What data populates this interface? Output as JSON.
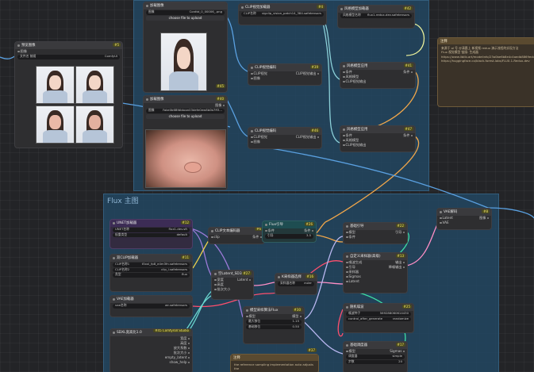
{
  "groups": {
    "top": {
      "title": ""
    },
    "bottom": {
      "title": "Flux 主图"
    }
  },
  "nodes": {
    "load_image_1": {
      "title": "加载图像",
      "filename_label": "图像",
      "filename": "Conttd_0_00006_.png",
      "button": "choose file to upload",
      "badge": "#45"
    },
    "load_image_2": {
      "title": "加载图像",
      "filename_label": "图像",
      "filename": "Fake0b6Bfdbtoon03defe0ew6b0b7ff3...",
      "button": "choose file to upload",
      "badge": "#40",
      "out_image": "图像",
      "out_mask": "遮罩"
    },
    "preview": {
      "title": "预览图像",
      "badge": "#5",
      "filename_label": "文件名 前缀",
      "filename": "ComfyUI",
      "in_images": "图像"
    },
    "clip_vision_loader": {
      "title": "CLIP视觉加载器",
      "badge": "#4",
      "label": "CLIP名称",
      "value": "sigclip_vision_patch14_384.safetensors",
      "out": "CLIP视觉"
    },
    "style_model_loader": {
      "title": "风格模型加载器",
      "badge": "#42",
      "label": "风格模型名称",
      "value": "flux1-redux-dev.safetensors",
      "out": "风格模型"
    },
    "clip_vision_encode_1": {
      "title": "CLIP视觉编码",
      "badge": "#39",
      "in1": "CLIP视觉",
      "in2": "图像",
      "out": "CLIP视觉输出"
    },
    "clip_vision_encode_2": {
      "title": "CLIP视觉编码",
      "badge": "#46",
      "in1": "CLIP视觉",
      "in2": "图像",
      "out": "CLIP视觉输出"
    },
    "apply_style_1": {
      "title": "风格模型应用",
      "badge": "#41",
      "in1": "条件",
      "in2": "风格模型",
      "in3": "CLIP视觉输出",
      "out": "条件"
    },
    "apply_style_2": {
      "title": "风格模型应用",
      "badge": "#47",
      "in1": "条件",
      "in2": "风格模型",
      "in3": "CLIP视觉输出",
      "out": "条件"
    },
    "note_top": {
      "title": "注释",
      "body": "来源于 ol 号 @清晨上 新视频 redux 演示流程的实现方法\nFlux 视觉模型 链接: 生成器\nhttps://www.liblib.art/modelinfo/23a0be6b8e4c4aedb8869ecbc58a03ca\nhttps://huggingface.co/black-forest-labs/FLUX.1-Redux-dev"
    },
    "unet_loader": {
      "title": "UNET加载器",
      "badge": "#12",
      "label1": "UNET名称",
      "value1": "flux1-dev.sft",
      "label2": "权重类型",
      "value2": "default",
      "out": "模型"
    },
    "dual_clip_loader": {
      "title": "双CLIP加载器",
      "badge": "#11",
      "label1": "CLIP名称1",
      "value1": "t5xxl_fp8_e4m3fn.safetensors",
      "label2": "CLIP名称2",
      "value2": "clip_l.safetensors",
      "label3": "类型",
      "value3": "flux",
      "out": "CLIP"
    },
    "vae_loader": {
      "title": "VAE加载器",
      "badge": "#10",
      "label": "vae名称",
      "value": "ae.safetensors",
      "out": "VAE"
    },
    "clip_text_encode": {
      "title": "CLIP文本编码器",
      "badge": "#6",
      "in": "clip",
      "out": "条件"
    },
    "flux_guidance": {
      "title": "Flux引导",
      "badge": "#26",
      "in": "条件",
      "label": "引导",
      "value": "3.5",
      "out": "条件"
    },
    "empty_latent": {
      "title": "空Latent_SD3",
      "badge": "#27",
      "label1": "宽度",
      "label2": "高度",
      "label3": "批次大小",
      "out": "Latent"
    },
    "model_sampling": {
      "title": "模型采样算法Flux",
      "badge": "#30",
      "in": "模型",
      "label1": "最大移位",
      "value1": "1.15",
      "label2": "基础移位",
      "value2": "0.50",
      "out": "模型"
    },
    "ksampler_select": {
      "title": "K采样器选择",
      "badge": "#16",
      "label": "采样器名称",
      "value": "euler",
      "out": "采样器"
    },
    "basic_guider": {
      "title": "基础引导",
      "badge": "#22",
      "in1": "模型",
      "in2": "条件",
      "out": "引导"
    },
    "custom_sampler": {
      "title": "自定义采样器(高级)",
      "badge": "#13",
      "in1": "噪波生成",
      "in2": "引导",
      "in3": "采样器",
      "in4": "Sigmas",
      "in5": "Latent",
      "out1": "输出",
      "out2": "降噪输出"
    },
    "random_noise": {
      "title": "随机噪波",
      "badge": "#25",
      "label1": "噪波种子",
      "value1": "569288060614430",
      "label2": "control_after_generate",
      "value2": "randomize"
    },
    "basic_scheduler": {
      "title": "基础调度器",
      "badge": "#17",
      "in": "模型",
      "label1": "调度器",
      "value1": "simple",
      "label2": "步数",
      "value2": "20",
      "out": "Sigmas"
    },
    "vae_decode": {
      "title": "VAE解码",
      "badge": "#8",
      "in1": "Latent",
      "in2": "VAE",
      "out": "图像"
    },
    "resolution": {
      "title": "SDXL宽高比1.0",
      "badge": "#45 Comfyroll Studio",
      "out1": "宽度",
      "out2": "高度",
      "out3": "放大系数",
      "out4": "批次大小",
      "out5": "empty_latent",
      "out6": "show_help"
    },
    "note_bottom": {
      "title": "注释",
      "badge": "#37",
      "body": "the reference sampling implementation auto adjusts the\nflux model. Use the sampling workflow will do that for you."
    }
  }
}
